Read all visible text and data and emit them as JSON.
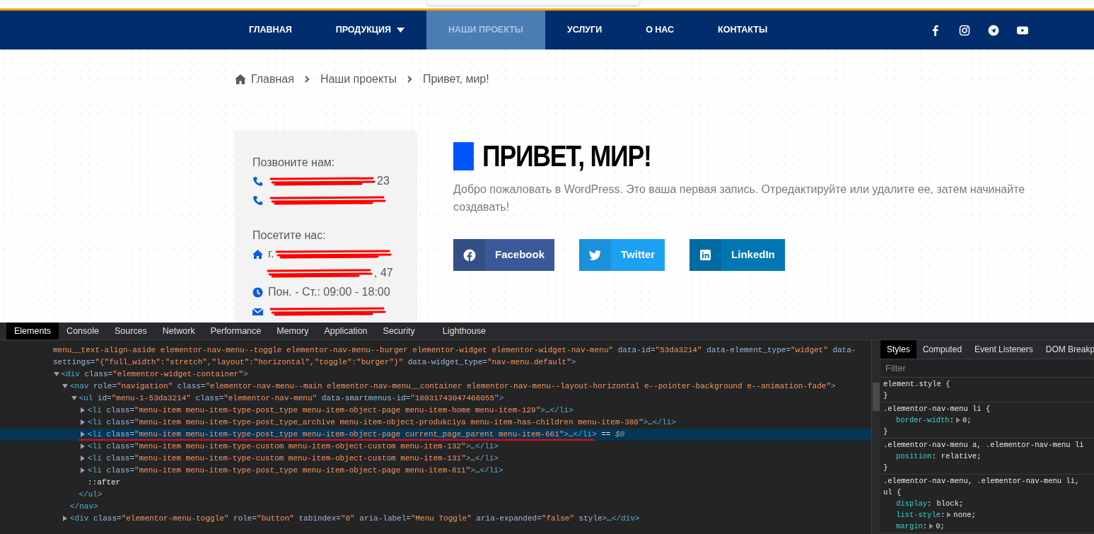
{
  "nav": {
    "items": [
      {
        "label": "ГЛАВНАЯ",
        "selected": false,
        "dropdown": false
      },
      {
        "label": "ПРОДУКЦИЯ",
        "selected": false,
        "dropdown": true
      },
      {
        "label": "НАШИ ПРОЕКТЫ",
        "selected": true,
        "dropdown": false
      },
      {
        "label": "УСЛУГИ",
        "selected": false,
        "dropdown": false
      },
      {
        "label": "О НАС",
        "selected": false,
        "dropdown": false
      },
      {
        "label": "КОНТАКТЫ",
        "selected": false,
        "dropdown": false
      }
    ],
    "social": [
      {
        "kind": "facebook"
      },
      {
        "kind": "instagram"
      },
      {
        "kind": "telegram"
      },
      {
        "kind": "youtube"
      }
    ]
  },
  "breadcrumb": [
    "Главная",
    "Наши проекты",
    "Привет, мир!"
  ],
  "contacts": [
    {
      "heading": "Позвоните нам:",
      "items": [
        {
          "kind": "phone",
          "redacted": true,
          "text_after": "23"
        },
        {
          "kind": "phone",
          "redacted": true
        }
      ]
    },
    {
      "heading": "Посетите нас:",
      "items": [
        {
          "kind": "address",
          "redacted": true,
          "text_before": "г."
        },
        {
          "kind": "address_cont",
          "redacted": true,
          "text_after": ", 47"
        },
        {
          "kind": "hours",
          "redacted": false,
          "text": "Пон. - Ст.: 09:00 - 18:00"
        },
        {
          "kind": "email",
          "redacted": true
        }
      ]
    }
  ],
  "post": {
    "title": "ПРИВЕТ, МИР!",
    "text": "Добро пожаловать в WordPress. Это ваша первая запись. Отредактируйте или удалите ее, затем начинайте создавать!",
    "share": [
      {
        "kind": "facebook",
        "label": "Facebook"
      },
      {
        "kind": "twitter",
        "label": "Twitter"
      },
      {
        "kind": "linkedin",
        "label": "LinkedIn"
      }
    ]
  },
  "devtools": {
    "tabs": [
      {
        "label": "Elements",
        "selected": true
      },
      {
        "label": "Console",
        "selected": false
      },
      {
        "label": "Sources",
        "selected": false
      },
      {
        "label": "Network",
        "selected": false
      },
      {
        "label": "Performance",
        "selected": false
      },
      {
        "label": "Memory",
        "selected": false
      },
      {
        "label": "Application",
        "selected": false
      },
      {
        "label": "Security",
        "selected": false
      },
      {
        "label": "Lighthouse",
        "selected": false
      }
    ],
    "tree": [
      {
        "selected": false,
        "lines": [
          [
            {
              "kind": "v",
              "text": "menu__text-align-aside elementor-nav-menu--toggle elementor-nav-menu--burger elementor-widget elementor-widget-nav-menu\""
            },
            {
              "kind": "a",
              "text": " data-id="
            },
            {
              "kind": "v",
              "text": "\"53da3214\""
            },
            {
              "kind": "a",
              "text": " data-element_type="
            },
            {
              "kind": "v",
              "text": "\"widget\""
            },
            {
              "kind": "a",
              "text": " data-"
            }
          ],
          [
            {
              "kind": "a",
              "text": "settings="
            },
            {
              "kind": "v",
              "text": "\"{\"full_width\":\"stretch\",\"layout\":\"horizontal\",\"toggle\":\"burger\"}\""
            },
            {
              "kind": "a",
              "text": " data-widget_type="
            },
            {
              "kind": "v",
              "text": "\"nav-menu.default\""
            },
            {
              "kind": "t",
              "text": ">"
            }
          ]
        ],
        "children": [
          {
            "selected": false,
            "expanded": true,
            "lines": [
              [
                {
                  "kind": "t",
                  "text": "<div"
                },
                {
                  "kind": "a",
                  "text": " class="
                },
                {
                  "kind": "v",
                  "text": "\"elementor-widget-container\""
                },
                {
                  "kind": "t",
                  "text": ">"
                }
              ]
            ],
            "children": [
              {
                "selected": false,
                "expanded": true,
                "lines": [
                  [
                    {
                      "kind": "t",
                      "text": "<nav"
                    },
                    {
                      "kind": "a",
                      "text": " role="
                    },
                    {
                      "kind": "v",
                      "text": "\"navigation\""
                    },
                    {
                      "kind": "a",
                      "text": " class="
                    },
                    {
                      "kind": "v",
                      "text": "\"elementor-nav-menu--main elementor-nav-menu__container elementor-nav-menu--layout-horizontal e--pointer-background e--animation-fade\""
                    },
                    {
                      "kind": "t",
                      "text": ">"
                    }
                  ]
                ],
                "close": "</nav>",
                "children": [
                  {
                    "selected": false,
                    "expanded": true,
                    "lines": [
                      [
                        {
                          "kind": "t",
                          "text": "<ul"
                        },
                        {
                          "kind": "a",
                          "text": " id="
                        },
                        {
                          "kind": "v",
                          "text": "\"menu-1-53da3214\""
                        },
                        {
                          "kind": "a",
                          "text": " class="
                        },
                        {
                          "kind": "v",
                          "text": "\"elementor-nav-menu\""
                        },
                        {
                          "kind": "a",
                          "text": " data-smartmenus-id="
                        },
                        {
                          "kind": "v",
                          "text": "\"16031743047466055\""
                        },
                        {
                          "kind": "t",
                          "text": ">"
                        }
                      ]
                    ],
                    "close": "</ul>",
                    "children": [
                      {
                        "selected": false,
                        "expanded": false,
                        "lines": [
                          [
                            {
                              "kind": "t",
                              "text": "<li"
                            },
                            {
                              "kind": "a",
                              "text": " class="
                            },
                            {
                              "kind": "v",
                              "text": "\"menu-item menu-item-type-post_type menu-item-object-page menu-item-home menu-item-129\""
                            },
                            {
                              "kind": "t",
                              "text": ">"
                            },
                            {
                              "kind": "p",
                              "text": "…"
                            },
                            {
                              "kind": "t",
                              "text": "</li>"
                            }
                          ]
                        ]
                      },
                      {
                        "selected": false,
                        "expanded": false,
                        "lines": [
                          [
                            {
                              "kind": "t",
                              "text": "<li"
                            },
                            {
                              "kind": "a",
                              "text": " class="
                            },
                            {
                              "kind": "v",
                              "text": "\"menu-item menu-item-type-post_type_archive menu-item-object-produkciya menu-item-has-children menu-item-386\""
                            },
                            {
                              "kind": "t",
                              "text": ">"
                            },
                            {
                              "kind": "p",
                              "text": "…"
                            },
                            {
                              "kind": "t",
                              "text": "</li>"
                            }
                          ]
                        ]
                      },
                      {
                        "selected": true,
                        "annotated": true,
                        "expanded": false,
                        "lines": [
                          [
                            {
                              "kind": "t",
                              "text": "<li"
                            },
                            {
                              "kind": "a",
                              "text": " class="
                            },
                            {
                              "kind": "v",
                              "text": "\"menu-item menu-item-type-post_type menu-item-object-page current_page_parent menu-item-661\""
                            },
                            {
                              "kind": "t",
                              "text": ">"
                            },
                            {
                              "kind": "p",
                              "text": "…"
                            },
                            {
                              "kind": "t",
                              "text": "</li>"
                            },
                            {
                              "kind": "p",
                              "text": " == "
                            },
                            {
                              "kind": "ref",
                              "text": "$0"
                            }
                          ]
                        ]
                      },
                      {
                        "selected": false,
                        "expanded": false,
                        "lines": [
                          [
                            {
                              "kind": "t",
                              "text": "<li"
                            },
                            {
                              "kind": "a",
                              "text": " class="
                            },
                            {
                              "kind": "v",
                              "text": "\"menu-item menu-item-type-custom menu-item-object-custom menu-item-132\""
                            },
                            {
                              "kind": "t",
                              "text": ">"
                            },
                            {
                              "kind": "p",
                              "text": "…"
                            },
                            {
                              "kind": "t",
                              "text": "</li>"
                            }
                          ]
                        ]
                      },
                      {
                        "selected": false,
                        "expanded": false,
                        "lines": [
                          [
                            {
                              "kind": "t",
                              "text": "<li"
                            },
                            {
                              "kind": "a",
                              "text": " class="
                            },
                            {
                              "kind": "v",
                              "text": "\"menu-item menu-item-type-custom menu-item-object-custom menu-item-131\""
                            },
                            {
                              "kind": "t",
                              "text": ">"
                            },
                            {
                              "kind": "p",
                              "text": "…"
                            },
                            {
                              "kind": "t",
                              "text": "</li>"
                            }
                          ]
                        ]
                      },
                      {
                        "selected": false,
                        "expanded": false,
                        "lines": [
                          [
                            {
                              "kind": "t",
                              "text": "<li"
                            },
                            {
                              "kind": "a",
                              "text": " class="
                            },
                            {
                              "kind": "v",
                              "text": "\"menu-item menu-item-type-post_type menu-item-object-page menu-item-611\""
                            },
                            {
                              "kind": "t",
                              "text": ">"
                            },
                            {
                              "kind": "p",
                              "text": "…"
                            },
                            {
                              "kind": "t",
                              "text": "</li>"
                            }
                          ]
                        ]
                      },
                      {
                        "selected": false,
                        "lines": [
                          [
                            {
                              "kind": "p",
                              "text": "::after"
                            }
                          ]
                        ]
                      }
                    ]
                  }
                ]
              },
              {
                "selected": false,
                "expanded": false,
                "lines": [
                  [
                    {
                      "kind": "t",
                      "text": "<div"
                    },
                    {
                      "kind": "a",
                      "text": " class="
                    },
                    {
                      "kind": "v",
                      "text": "\"elementor-menu-toggle\""
                    },
                    {
                      "kind": "a",
                      "text": " role="
                    },
                    {
                      "kind": "v",
                      "text": "\"button\""
                    },
                    {
                      "kind": "a",
                      "text": " tabindex="
                    },
                    {
                      "kind": "v",
                      "text": "\"0\""
                    },
                    {
                      "kind": "a",
                      "text": " aria-label="
                    },
                    {
                      "kind": "v",
                      "text": "\"Menu Toggle\""
                    },
                    {
                      "kind": "a",
                      "text": " aria-expanded="
                    },
                    {
                      "kind": "v",
                      "text": "\"false\""
                    },
                    {
                      "kind": "a",
                      "text": " style"
                    },
                    {
                      "kind": "t",
                      "text": ">"
                    },
                    {
                      "kind": "p",
                      "text": "…"
                    },
                    {
                      "kind": "t",
                      "text": "</div>"
                    }
                  ]
                ]
              }
            ]
          }
        ]
      }
    ],
    "side_tabs": [
      {
        "label": "Styles",
        "selected": true
      },
      {
        "label": "Computed",
        "selected": false
      },
      {
        "label": "Event Listeners",
        "selected": false
      },
      {
        "label": "DOM Breakp",
        "selected": false
      }
    ],
    "filter": {
      "placeholder": "Filter"
    },
    "rules": [
      {
        "selector": "element.style {",
        "close": "}"
      },
      {
        "selector": ".elementor-nav-menu li {",
        "declarations": [
          {
            "property": "border-width",
            "colon": ":",
            "value": "0;",
            "expandable": true
          }
        ],
        "close": "}"
      },
      {
        "selector": ".elementor-nav-menu a, .elementor-nav-menu li",
        "declarations": [
          {
            "property": "position",
            "colon": ":",
            "value": "relative;",
            "expandable": false
          }
        ],
        "close": "}"
      },
      {
        "selector": ".elementor-nav-menu, .elementor-nav-menu li, ul {",
        "declarations": [
          {
            "property": "display",
            "colon": ":",
            "value": "block;",
            "expandable": false
          },
          {
            "property": "list-style",
            "colon": ":",
            "value": "none;",
            "expandable": true
          },
          {
            "property": "margin",
            "colon": ":",
            "value": "0;",
            "expandable": true
          }
        ]
      }
    ]
  }
}
